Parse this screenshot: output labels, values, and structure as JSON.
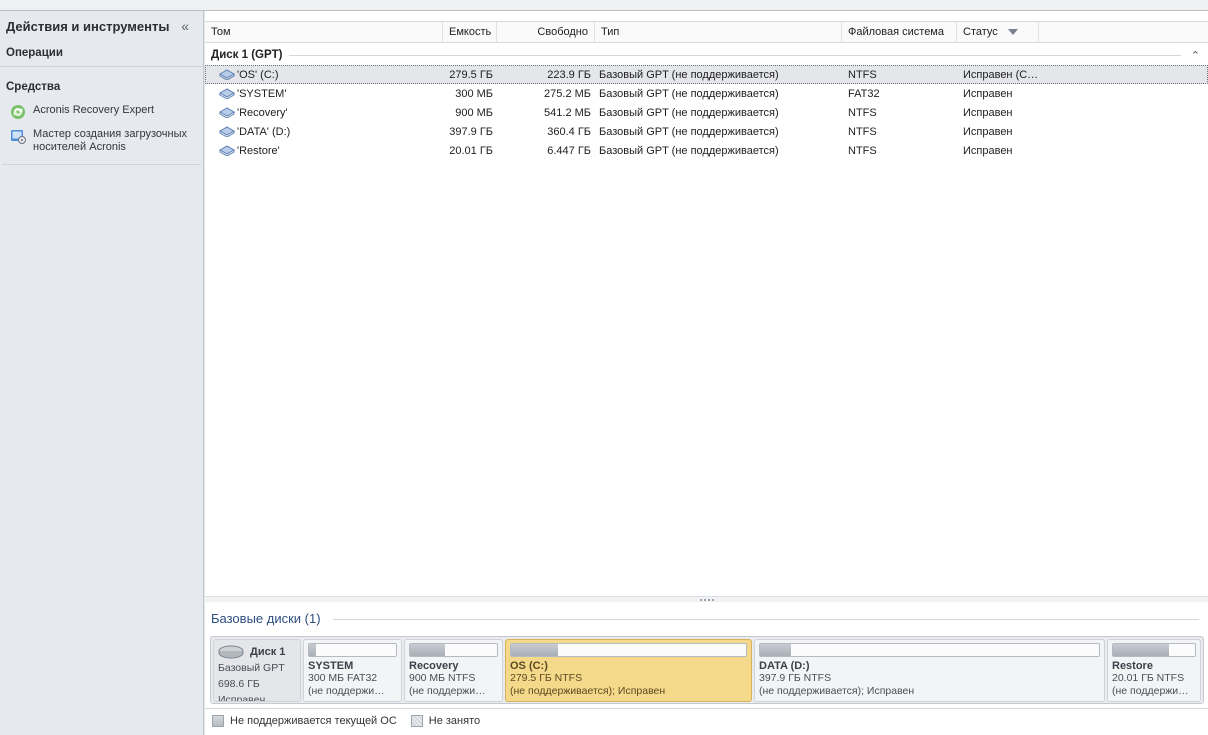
{
  "sidebar": {
    "title": "Действия и инструменты",
    "collapse_glyph": "«",
    "sections": {
      "operations": "Операции",
      "tools": "Средства"
    },
    "items": [
      {
        "label": "Acronis Recovery Expert",
        "icon": "recovery-expert-icon"
      },
      {
        "label": "Мастер создания загрузочных носителей Acronis",
        "icon": "bootable-media-icon"
      }
    ]
  },
  "table": {
    "columns": {
      "volume": "Том",
      "capacity": "Емкость",
      "free": "Свободно",
      "type": "Тип",
      "fs": "Файловая система",
      "status": "Статус"
    },
    "group": {
      "title": "Диск 1 (GPT)",
      "collapse_glyph": "⌃"
    },
    "rows": [
      {
        "volume": "'OS' (C:)",
        "capacity": "279.5 ГБ",
        "free": "223.9 ГБ",
        "type": "Базовый GPT (не поддерживается)",
        "fs": "NTFS",
        "status": "Исправен (С…"
      },
      {
        "volume": "'SYSTEM'",
        "capacity": "300 МБ",
        "free": "275.2 МБ",
        "type": "Базовый GPT (не поддерживается)",
        "fs": "FAT32",
        "status": "Исправен"
      },
      {
        "volume": "'Recovery'",
        "capacity": "900 МБ",
        "free": "541.2 МБ",
        "type": "Базовый GPT (не поддерживается)",
        "fs": "NTFS",
        "status": "Исправен"
      },
      {
        "volume": "'DATA' (D:)",
        "capacity": "397.9 ГБ",
        "free": "360.4 ГБ",
        "type": "Базовый GPT (не поддерживается)",
        "fs": "NTFS",
        "status": "Исправен"
      },
      {
        "volume": "'Restore'",
        "capacity": "20.01 ГБ",
        "free": "6.447 ГБ",
        "type": "Базовый GPT (не поддерживается)",
        "fs": "NTFS",
        "status": "Исправен"
      }
    ]
  },
  "basic_disks": {
    "title": "Базовые диски (1)",
    "disk": {
      "name": "Диск 1",
      "type": "Базовый GPT",
      "size": "698.6 ГБ",
      "status": "Исправен"
    },
    "partitions": [
      {
        "name": "SYSTEM",
        "line1": "300 МБ FAT32",
        "line2": "(не поддержи…",
        "used_fraction": 0.08
      },
      {
        "name": "Recovery",
        "line1": "900 МБ NTFS",
        "line2": "(не поддержи…",
        "used_fraction": 0.4
      },
      {
        "name": "OS (C:)",
        "line1": "279.5 ГБ NTFS",
        "line2": "(не поддерживается); Исправен",
        "used_fraction": 0.2
      },
      {
        "name": "DATA (D:)",
        "line1": "397.9 ГБ NTFS",
        "line2": "(не поддерживается); Исправен",
        "used_fraction": 0.09
      },
      {
        "name": "Restore",
        "line1": "20.01 ГБ NTFS",
        "line2": "(не поддержи…",
        "used_fraction": 0.68
      }
    ]
  },
  "legend": {
    "unsupported": "Не поддерживается текущей ОС",
    "free": "Не занято"
  }
}
